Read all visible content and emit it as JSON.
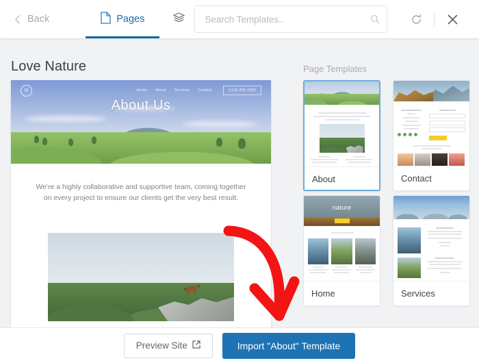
{
  "header": {
    "back_label": "Back",
    "back_icon": "chevron-left-icon",
    "tab_label": "Pages",
    "tab_icon": "document-icon",
    "layers_icon": "layers-icon",
    "search": {
      "placeholder": "Search Templates..",
      "value": "",
      "icon": "search-icon"
    },
    "refresh_icon": "refresh-icon",
    "close_icon": "close-icon"
  },
  "main": {
    "page_title": "Love Nature",
    "panel_title": "Page Templates"
  },
  "preview": {
    "logo": "N",
    "nav_links": [
      "Home",
      "About",
      "Services",
      "Contact"
    ],
    "phone": "(123) 456-7890",
    "hero_title": "About Us",
    "paragraph": "We're a highly collaborative and supportive team, coming together on every project to ensure our clients get the very best result."
  },
  "templates": [
    {
      "name": "About",
      "selected": true
    },
    {
      "name": "Contact",
      "selected": false
    },
    {
      "name": "Home",
      "selected": false,
      "hero_title": "nature"
    },
    {
      "name": "Services",
      "selected": false
    }
  ],
  "footer": {
    "preview_label": "Preview Site",
    "preview_icon": "external-link-icon",
    "import_label": "Import \"About\" Template"
  },
  "annotation": {
    "arrow_icon": "red-curved-arrow-icon",
    "color": "#f31414"
  },
  "colors": {
    "accent_blue": "#1d73b3",
    "tab_underline": "#11699f",
    "selected_border": "#6aaede",
    "page_bg": "#f1f2f4",
    "yellow": "#f5cc2b"
  }
}
